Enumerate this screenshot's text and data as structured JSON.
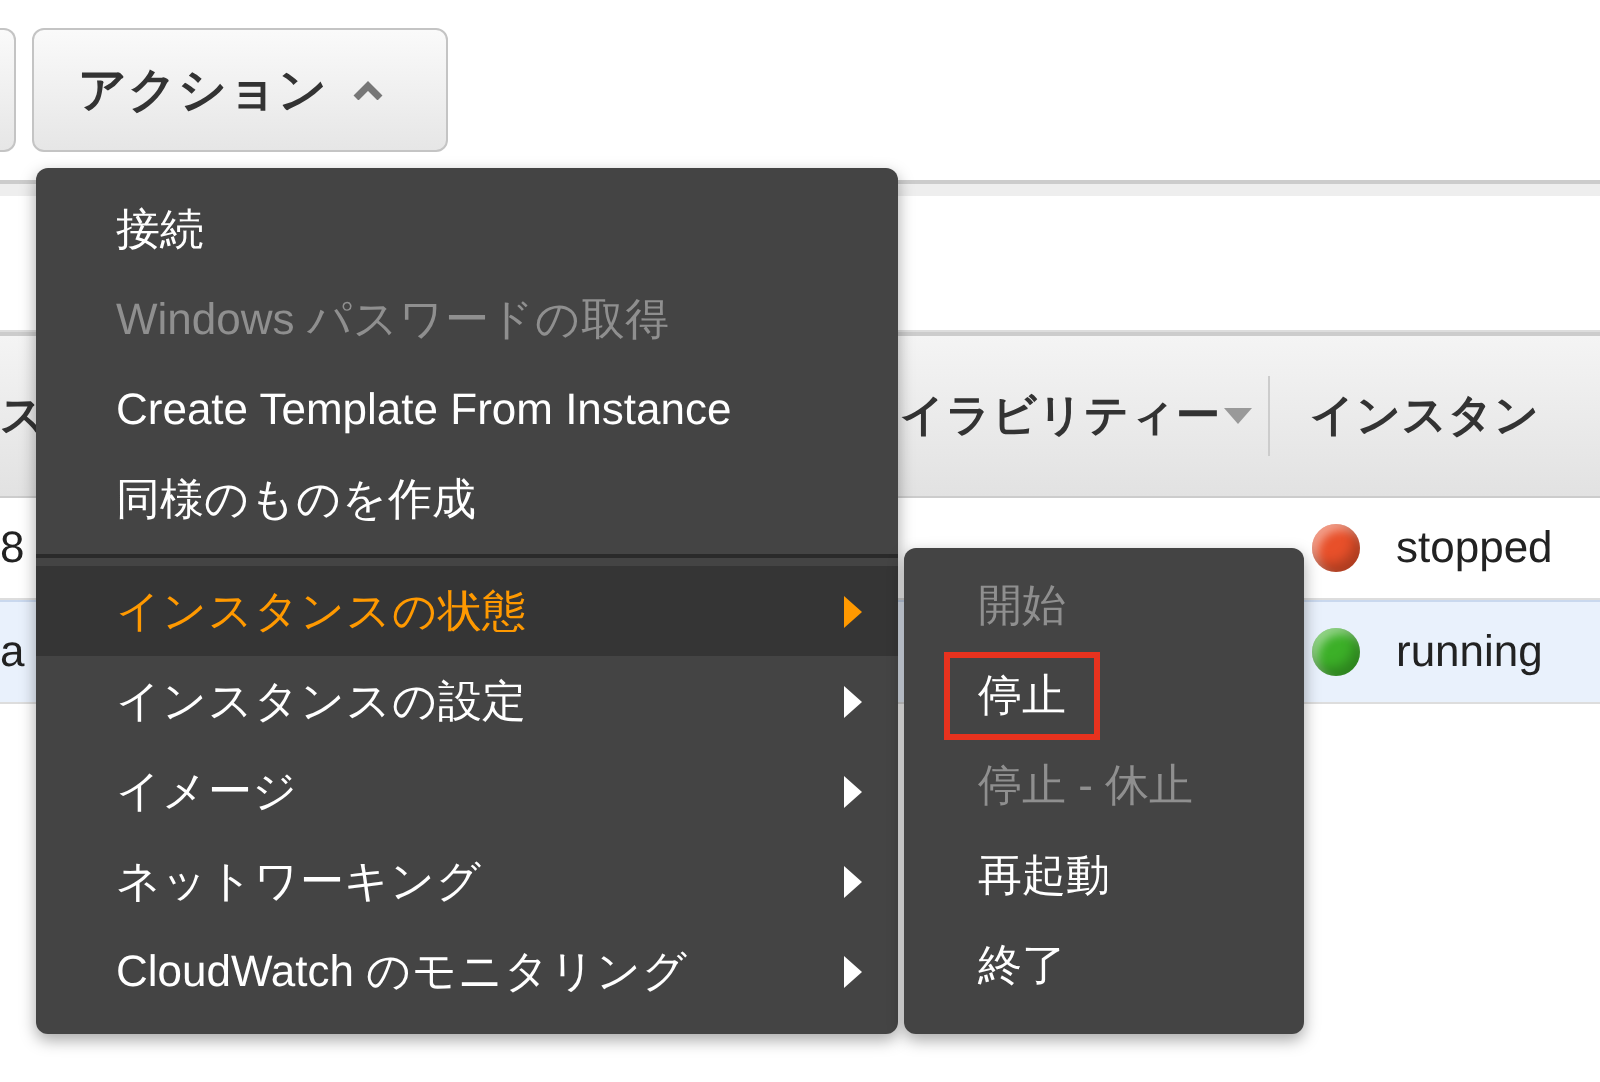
{
  "toolbar": {
    "actions_button": {
      "label": "アクション",
      "expanded": true
    }
  },
  "table": {
    "columns": [
      {
        "label": "ス"
      },
      {
        "label": "イラビリティー",
        "sortable": true
      },
      {
        "label": "インスタン",
        "sortable": false
      }
    ],
    "rows": [
      {
        "column_1": "8",
        "status": "stopped",
        "color": "#e8502a",
        "selected": false
      },
      {
        "column_1": "a",
        "status": "running",
        "color": "#3cb028",
        "selected": true
      }
    ]
  },
  "actions_menu": {
    "items": [
      {
        "kind": "item",
        "label": "接続",
        "disabled": false,
        "highlighted": false,
        "submenu": false
      },
      {
        "kind": "item",
        "label": "Windows パスワードの取得",
        "disabled": true,
        "highlighted": false,
        "submenu": false
      },
      {
        "kind": "item",
        "label": "Create Template From Instance",
        "disabled": false,
        "highlighted": false,
        "submenu": false
      },
      {
        "kind": "item",
        "label": "同様のものを作成",
        "disabled": false,
        "highlighted": false,
        "submenu": false
      },
      {
        "kind": "separator"
      },
      {
        "kind": "item",
        "label": "インスタンスの状態",
        "disabled": false,
        "highlighted": true,
        "submenu": true
      },
      {
        "kind": "item",
        "label": "インスタンスの設定",
        "disabled": false,
        "highlighted": false,
        "submenu": true
      },
      {
        "kind": "item",
        "label": "イメージ",
        "disabled": false,
        "highlighted": false,
        "submenu": true
      },
      {
        "kind": "item",
        "label": "ネットワーキング",
        "disabled": false,
        "highlighted": false,
        "submenu": true
      },
      {
        "kind": "item",
        "label": "CloudWatch のモニタリング",
        "disabled": false,
        "highlighted": false,
        "submenu": true
      }
    ]
  },
  "state_submenu": {
    "items": [
      {
        "label": "開始",
        "disabled": true,
        "outlined": false
      },
      {
        "label": "停止",
        "disabled": false,
        "outlined": true
      },
      {
        "label": "停止 - 休止",
        "disabled": true,
        "outlined": false
      },
      {
        "label": "再起動",
        "disabled": false,
        "outlined": false
      },
      {
        "label": "終了",
        "disabled": false,
        "outlined": false
      }
    ]
  }
}
